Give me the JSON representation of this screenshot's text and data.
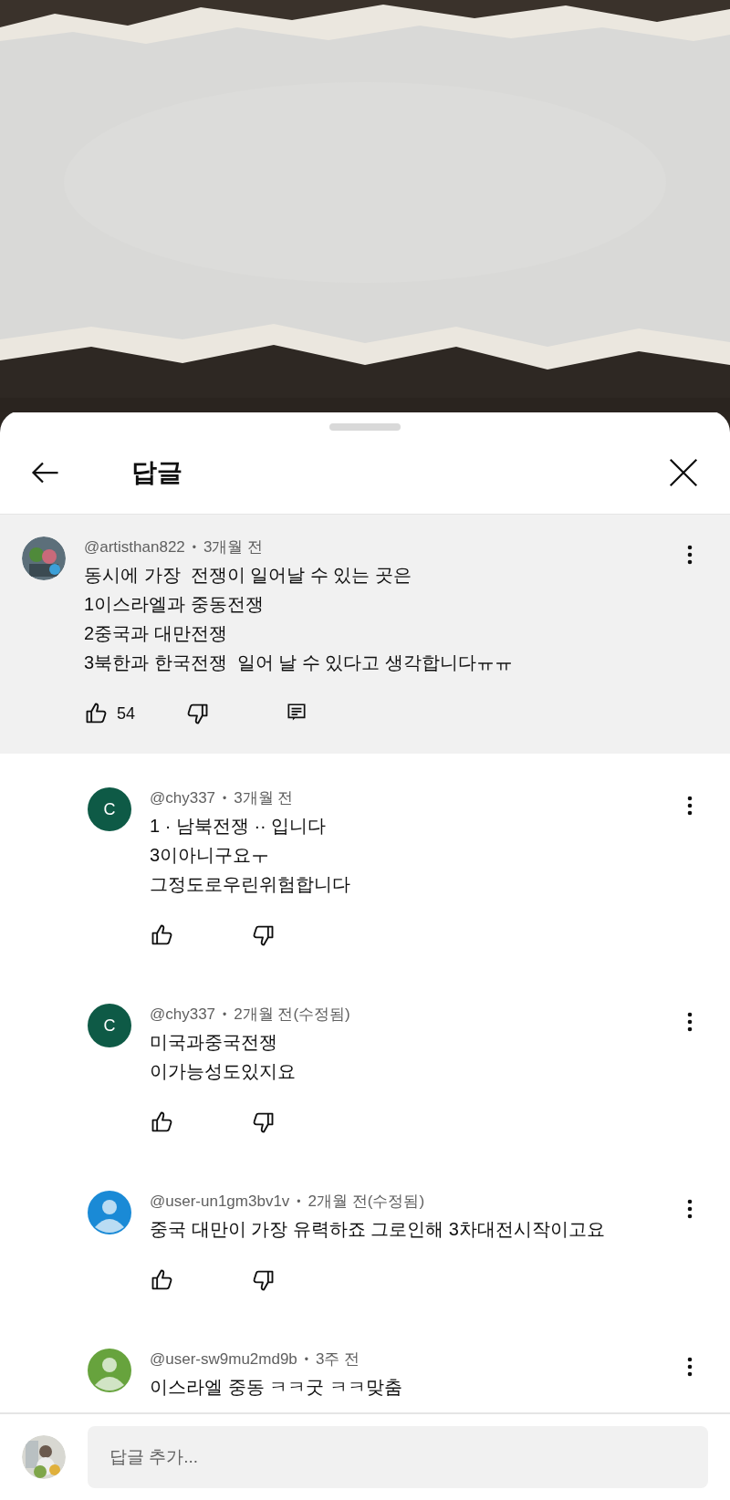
{
  "panel": {
    "title": "답글"
  },
  "comment": {
    "author": "@artisthan822",
    "separator": "•",
    "time": "3개월 전",
    "lines": [
      "동시에 가장  전쟁이 일어날 수 있는 곳은",
      "1이스라엘과 중동전쟁",
      "2중국과 대만전쟁",
      "3북한과 한국전쟁  일어 날 수 있다고 생각합니다ㅠㅠ"
    ],
    "likes": "54"
  },
  "replies": [
    {
      "author": "@chy337",
      "separator": "•",
      "time": "3개월 전",
      "avatar": {
        "kind": "letter",
        "letter": "C",
        "color": "#0e5a46"
      },
      "lines": [
        "1 · 남북전쟁 ·· 입니다",
        "3이아니구요ㅜ",
        "그정도로우린위험합니다"
      ],
      "actions": true
    },
    {
      "author": "@chy337",
      "separator": "•",
      "time": "2개월 전(수정됨)",
      "avatar": {
        "kind": "letter",
        "letter": "C",
        "color": "#0e5a46"
      },
      "lines": [
        "미국과중국전쟁",
        "이가능성도있지요"
      ],
      "actions": true
    },
    {
      "author": "@user-un1gm3bv1v",
      "separator": "•",
      "time": "2개월 전(수정됨)",
      "avatar": {
        "kind": "default",
        "color": "#1a8ad6"
      },
      "lines": [
        "중국 대만이 가장 유력하죠 그로인해 3차대전시작이고요"
      ],
      "actions": true
    },
    {
      "author": "@user-sw9mu2md9b",
      "separator": "•",
      "time": "3주 전",
      "avatar": {
        "kind": "default",
        "color": "#67a33d"
      },
      "lines": [
        "이스라엘 중동 ㅋㅋ굿 ㅋㅋ맞춤"
      ],
      "actions": false
    }
  ],
  "reply_box": {
    "placeholder": "답글 추가..."
  }
}
